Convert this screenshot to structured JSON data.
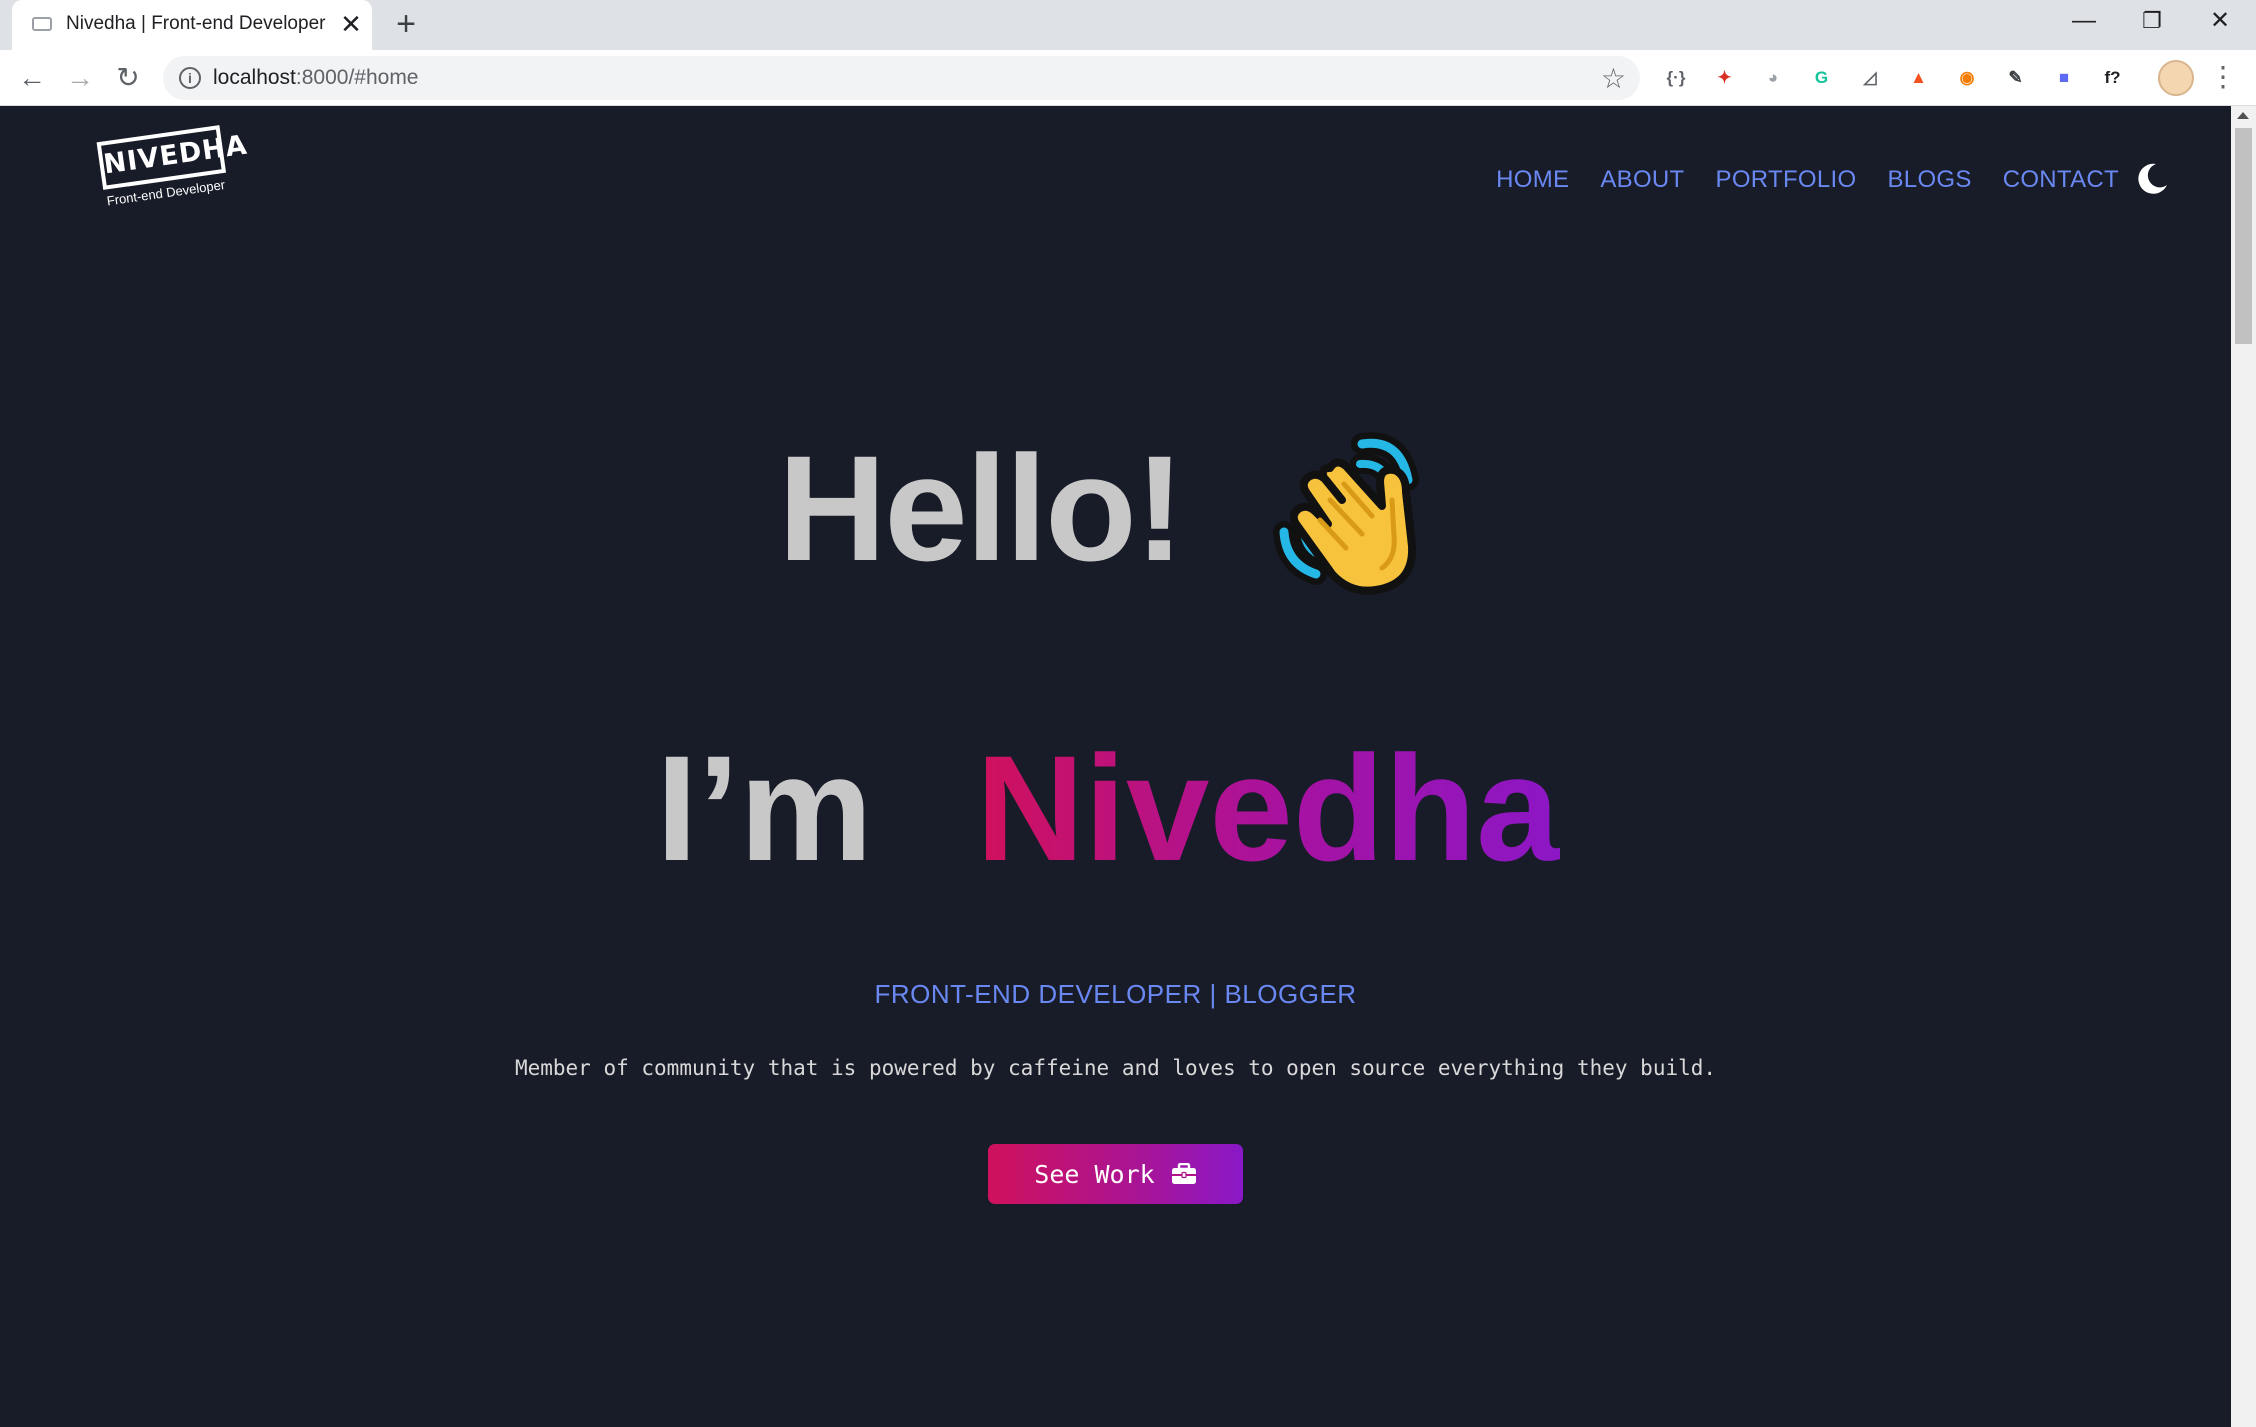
{
  "browser": {
    "tab_title": "Nivedha | Front-end Developer",
    "tab_close": "✕",
    "new_tab": "+",
    "url_host": "localhost",
    "url_rest": ":8000/#home",
    "extensions": [
      {
        "name": "devtools-extension-icon",
        "glyph": "{·}",
        "color": "#5f6368"
      },
      {
        "name": "red-extension-icon",
        "glyph": "✦",
        "color": "#d93025"
      },
      {
        "name": "panda-extension-icon",
        "glyph": "◕",
        "color": "#9aa0a6"
      },
      {
        "name": "grammarly-icon",
        "glyph": "G",
        "color": "#15c39a"
      },
      {
        "name": "page-ruler-icon",
        "glyph": "◿",
        "color": "#5f6368"
      },
      {
        "name": "lighthouse-icon",
        "glyph": "▲",
        "color": "#f4511e"
      },
      {
        "name": "orange-extension-icon",
        "glyph": "◉",
        "color": "#f57c00"
      },
      {
        "name": "eyedropper-icon",
        "glyph": "✎",
        "color": "#3c4043"
      },
      {
        "name": "gradient-extension-icon",
        "glyph": "■",
        "color": "#5c6bf2"
      },
      {
        "name": "whatfont-icon",
        "glyph": "f?",
        "color": "#202124"
      }
    ]
  },
  "page": {
    "logo_text": "NIVEDHA",
    "logo_subtitle": "Front-end Developer",
    "nav": [
      {
        "label": "HOME"
      },
      {
        "label": "ABOUT"
      },
      {
        "label": "PORTFOLIO"
      },
      {
        "label": "BLOGS"
      },
      {
        "label": "CONTACT"
      }
    ],
    "hero": {
      "greeting": "Hello!",
      "intro": "I’m",
      "name": "Nivedha",
      "role": "FRONT-END DEVELOPER | BLOGGER",
      "tagline": "Member of community that is powered by caffeine and loves to open source everything they build.",
      "cta_label": "See Work"
    },
    "colors": {
      "background": "#181b28",
      "nav_link": "#6a88f2",
      "gradient_start": "#d0115c",
      "gradient_end": "#8c17c6"
    }
  }
}
